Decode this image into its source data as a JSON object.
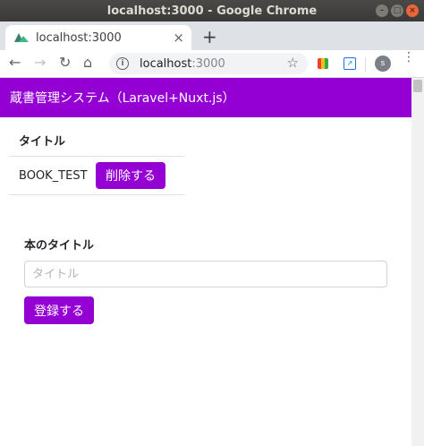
{
  "window": {
    "title": "localhost:3000 - Google Chrome",
    "controls": {
      "minimize": "–",
      "maximize": "□",
      "close": "×"
    }
  },
  "tabs": [
    {
      "label": "localhost:3000",
      "close": "×"
    }
  ],
  "new_tab": "+",
  "toolbar": {
    "back": "←",
    "forward": "→",
    "reload": "↻",
    "home": "⌂",
    "info": "i",
    "url_host": "localhost",
    "url_port": ":3000",
    "star": "☆",
    "ext_label": "↗",
    "avatar": "s",
    "menu": "⋮"
  },
  "app": {
    "header": "蔵書管理システム（Laravel+Nuxt.js）",
    "table": {
      "header": "タイトル",
      "rows": [
        {
          "title": "BOOK_TEST",
          "delete_label": "削除する"
        }
      ]
    },
    "form": {
      "label": "本のタイトル",
      "input_placeholder": "タイトル",
      "input_value": "",
      "submit_label": "登録する"
    }
  },
  "colors": {
    "accent": "#9400d3",
    "titlebar": "#3b3a38",
    "tabstrip": "#dee1e6"
  }
}
